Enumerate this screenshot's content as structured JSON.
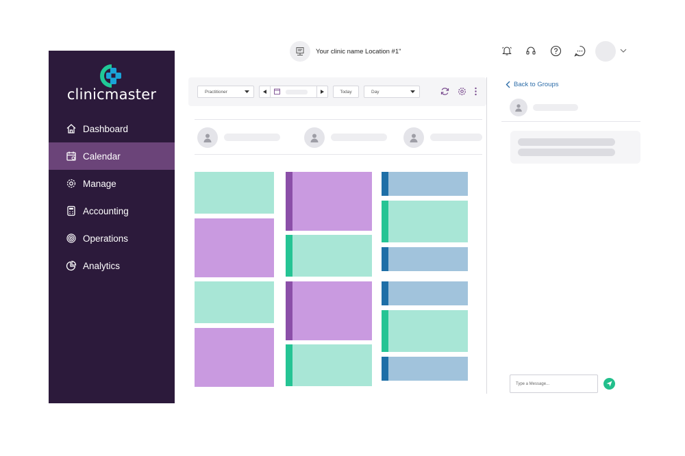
{
  "brand": {
    "name": "clinicmaster"
  },
  "sidebar": {
    "items": [
      {
        "label": "Dashboard",
        "icon": "home-icon"
      },
      {
        "label": "Calendar",
        "icon": "calendar-icon",
        "active": true
      },
      {
        "label": "Manage",
        "icon": "gear-icon"
      },
      {
        "label": "Accounting",
        "icon": "calculator-icon"
      },
      {
        "label": "Operations",
        "icon": "operations-icon"
      },
      {
        "label": "Analytics",
        "icon": "pie-chart-icon"
      }
    ]
  },
  "header": {
    "clinic_name": "Your clinic name Location #1\"",
    "icons": [
      "bell-icon",
      "headset-icon",
      "help-icon",
      "chat-icon",
      "chevron-down-icon"
    ]
  },
  "toolbar": {
    "practitioner_label": "Practitioner",
    "today_label": "Today",
    "view_label": "Day"
  },
  "chat": {
    "back_label": "Back to Groups",
    "input_placeholder": "Type a Message..."
  },
  "colors": {
    "sidebar_bg": "#2c1a3b",
    "sidebar_active": "#6b4479",
    "appointment_teal": "#a8e6d6",
    "appointment_purple": "#c99ae0",
    "appointment_blue": "#a1c3dc",
    "accent_green": "#22bf8c",
    "link_blue": "#2c6ca8"
  }
}
